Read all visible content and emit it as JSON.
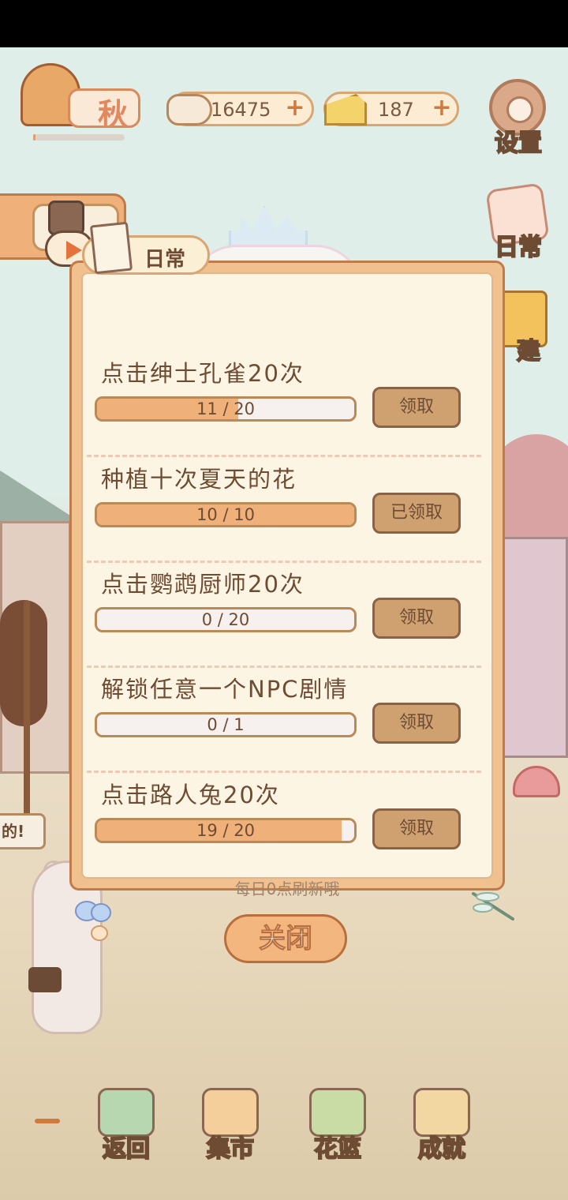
{
  "hud": {
    "season": "秋",
    "season_progress": 0.03,
    "fish_count": "16475",
    "cheese_count": "187",
    "plus_symbol": "+"
  },
  "side_menu": {
    "settings": "设置",
    "daily": "日常",
    "build": "建"
  },
  "background_sign": "的!",
  "modal": {
    "tab_label": "日常",
    "tasks": [
      {
        "title": "点击绅士孔雀20次",
        "progress_text": "11 / 20",
        "progress": 0.55,
        "button": "领取"
      },
      {
        "title": "种植十次夏天的花",
        "progress_text": "10 / 10",
        "progress": 1.0,
        "button": "已领取"
      },
      {
        "title": "点击鹦鹉厨师20次",
        "progress_text": "0 / 20",
        "progress": 0.0,
        "button": "领取"
      },
      {
        "title": "解锁任意一个NPC剧情",
        "progress_text": "0 / 1",
        "progress": 0.0,
        "button": "领取"
      },
      {
        "title": "点击路人兔20次",
        "progress_text": "19 / 20",
        "progress": 0.95,
        "button": "领取"
      }
    ],
    "refresh_note": "每日0点刷新哦",
    "close": "关闭"
  },
  "bottom_nav": {
    "back": "返回",
    "market": "集市",
    "basket": "花篮",
    "achievement": "成就"
  },
  "icons": {
    "season": "tree-icon",
    "fish": "fish-bone-icon",
    "cheese": "cheese-icon",
    "settings": "gear-icon",
    "daily": "note-icon",
    "build": "hammer-icon",
    "bag": "briefcase-icon",
    "play": "play-icon"
  }
}
